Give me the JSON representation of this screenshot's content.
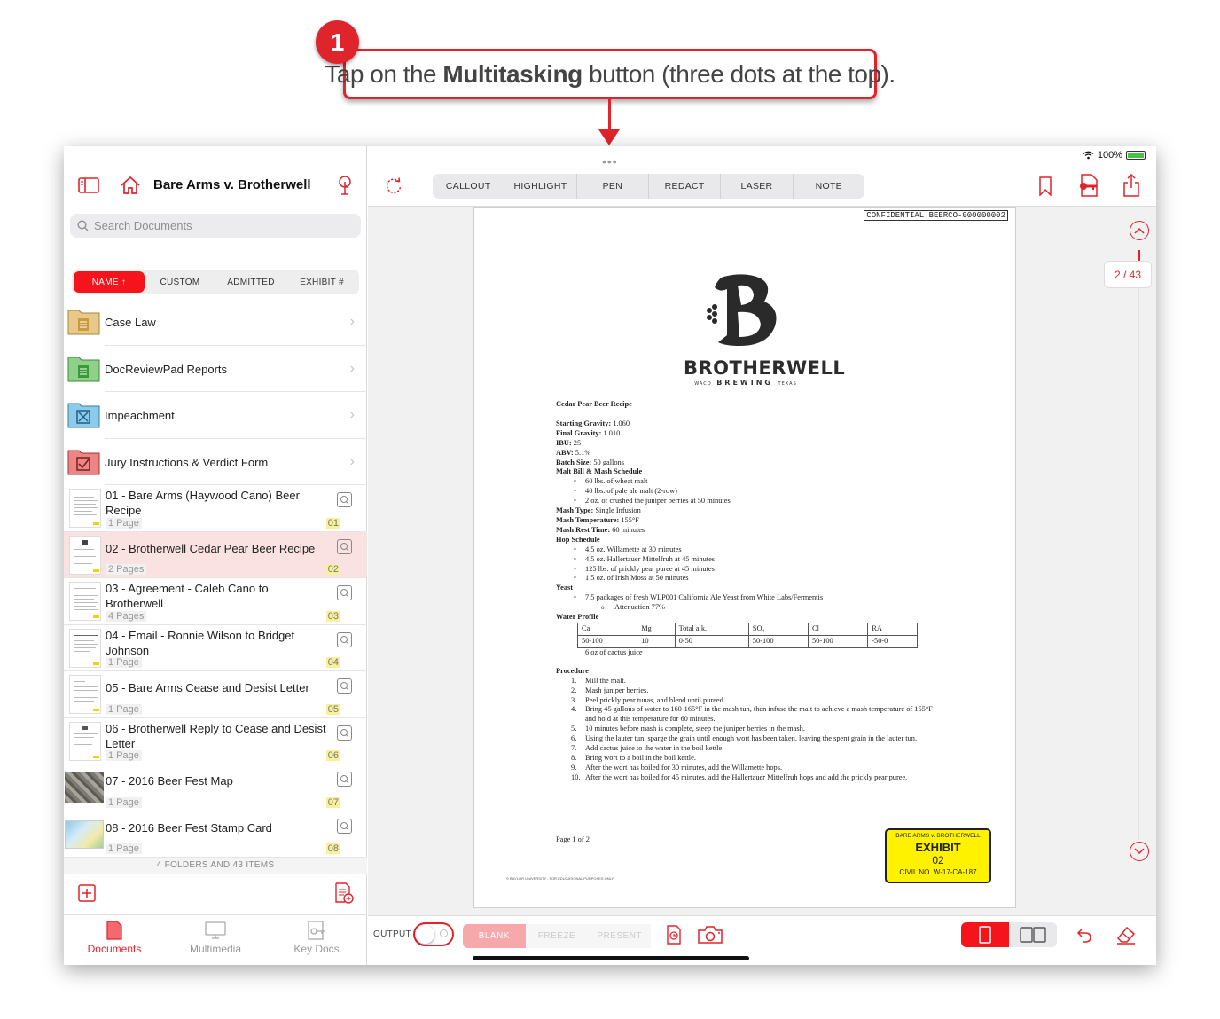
{
  "callout": {
    "number": "1",
    "text_before": "Tap on the ",
    "text_bold": "Multitasking",
    "text_after": " button (three dots at the top)."
  },
  "sidebar": {
    "title": "Bare Arms v. Brotherwell",
    "search_placeholder": "Search Documents",
    "sort_tabs": [
      "NAME ↑",
      "CUSTOM",
      "ADMITTED",
      "EXHIBIT #"
    ],
    "folders": [
      {
        "label": "Case Law",
        "color": "#e9c98a"
      },
      {
        "label": "DocReviewPad Reports",
        "color": "#8fd18a"
      },
      {
        "label": "Impeachment",
        "color": "#8ccbe9"
      },
      {
        "label": "Jury Instructions & Verdict Form",
        "color": "#ec8585"
      }
    ],
    "documents": [
      {
        "title": "01 - Bare Arms (Haywood Cano) Beer Recipe",
        "pages": "1 Page",
        "exhibit": "01"
      },
      {
        "title": "02 - Brotherwell Cedar Pear Beer Recipe",
        "pages": "2 Pages",
        "exhibit": "02"
      },
      {
        "title": "03 - Agreement - Caleb Cano to Brotherwell",
        "pages": "4 Pages",
        "exhibit": "03"
      },
      {
        "title": "04 - Email - Ronnie Wilson to Bridget Johnson",
        "pages": "1 Page",
        "exhibit": "04"
      },
      {
        "title": "05 - Bare Arms Cease and Desist Letter",
        "pages": "1 Page",
        "exhibit": "05"
      },
      {
        "title": "06 - Brotherwell Reply to Cease and Desist Letter",
        "pages": "1 Page",
        "exhibit": "06"
      },
      {
        "title": "07 - 2016 Beer Fest Map",
        "pages": "1 Page",
        "exhibit": "07"
      },
      {
        "title": "08 - 2016 Beer Fest Stamp Card",
        "pages": "1 Page",
        "exhibit": "08"
      }
    ],
    "count_text": "4 FOLDERS AND 43 ITEMS",
    "tabs": [
      "Documents",
      "Multimedia",
      "Key Docs"
    ]
  },
  "topbar": {
    "dots": "•••",
    "battery": "100%",
    "tools": [
      "CALLOUT",
      "HIGHLIGHT",
      "PEN",
      "REDACT",
      "LASER",
      "NOTE"
    ]
  },
  "document": {
    "confidential": "CONFIDENTIAL BEERCO-000000002",
    "logo_brand": "BROTHERWELL",
    "logo_sub_left": "WACO",
    "logo_sub_mid": "BREWING",
    "logo_sub_right": "TEXAS",
    "recipe_title": "Cedar Pear Beer Recipe",
    "stats": [
      {
        "k": "Starting Gravity:",
        "v": " 1.060"
      },
      {
        "k": "Final Gravity:",
        "v": " 1.010"
      },
      {
        "k": "IBU:",
        "v": " 25"
      },
      {
        "k": "ABV:",
        "v": " 5.1%"
      },
      {
        "k": "Batch Size:",
        "v": " 50 gallons"
      }
    ],
    "malt_heading": "Malt Bill & Mash Schedule",
    "malt_items": [
      "60 lbs. of wheat malt",
      "40 lbs. of pale ale malt (2-row)",
      "2 oz. of crushed the juniper berries at 50 minutes"
    ],
    "mash": [
      {
        "k": "Mash Type:",
        "v": " Single Infusion"
      },
      {
        "k": "Mash Temperature:",
        "v": " 155°F"
      },
      {
        "k": "Mash Rest Time:",
        "v": " 60 minutes"
      }
    ],
    "hop_heading": "Hop Schedule",
    "hop_items": [
      "4.5 oz. Willamette at 30 minutes",
      "4.5 oz. Hallertauer Mittelfruh at 45 minutes",
      "125 lbs. of prickly pear puree at 45 minutes",
      "1.5 oz. of Irish Moss at 50 minutes"
    ],
    "yeast_heading": "Yeast",
    "yeast_item": "7.5 packages of fresh WLP001 California Ale Yeast from White Labs/Fermentis",
    "yeast_sub": "Attenuation 77%",
    "water_heading": "Water Profile",
    "water_headers": [
      "Ca",
      "Mg",
      "Total alk.",
      "SO₄",
      "Cl",
      "RA"
    ],
    "water_values": [
      "50-100",
      "10",
      "0-50",
      "50-100",
      "50-100",
      "-50-0"
    ],
    "cactus": "6 oz of cactus juice",
    "procedure_heading": "Procedure",
    "procedure": [
      "Mill the malt.",
      "Mash juniper berries.",
      "Peel prickly pear tunas, and blend until pureed.",
      "Bring 45 gallons of water to 160-165°F in the mash tun, then infuse the malt to achieve a mash temperature of 155°F and hold at this temperature for 60 minutes.",
      "10 minutes before mash is complete, steep the juniper berries in the mash.",
      "Using the lauter tun, sparge the grain until enough wort has been taken, leaving the spent grain in the lauter tun.",
      "Add cactus juice to the water in the boil kettle.",
      "Bring wort to a boil in the boil kettle.",
      "After the wort has boiled for 30 minutes, add the Willamette hops.",
      "After the wort has boiled for 45 minutes, add the Hallertauer Mittelfruh hops and add the prickly pear puree."
    ],
    "page_of": "Page 1 of 2",
    "university": "© BAYLOR UNIVERSITY - FOR EDUCATIONAL PURPOSES ONLY",
    "sticker": {
      "case": "BARE ARMS v. BROTHERWELL",
      "label": "EXHIBIT",
      "number": "02",
      "civil": "CIVIL NO. W-17-CA-187"
    }
  },
  "navigator": {
    "page_indicator": "2 / 43"
  },
  "bottombar": {
    "output_label": "OUTPUT",
    "modes": [
      "BLANK",
      "FREEZE",
      "PRESENT"
    ]
  },
  "colors": {
    "accent": "#e0242b"
  }
}
